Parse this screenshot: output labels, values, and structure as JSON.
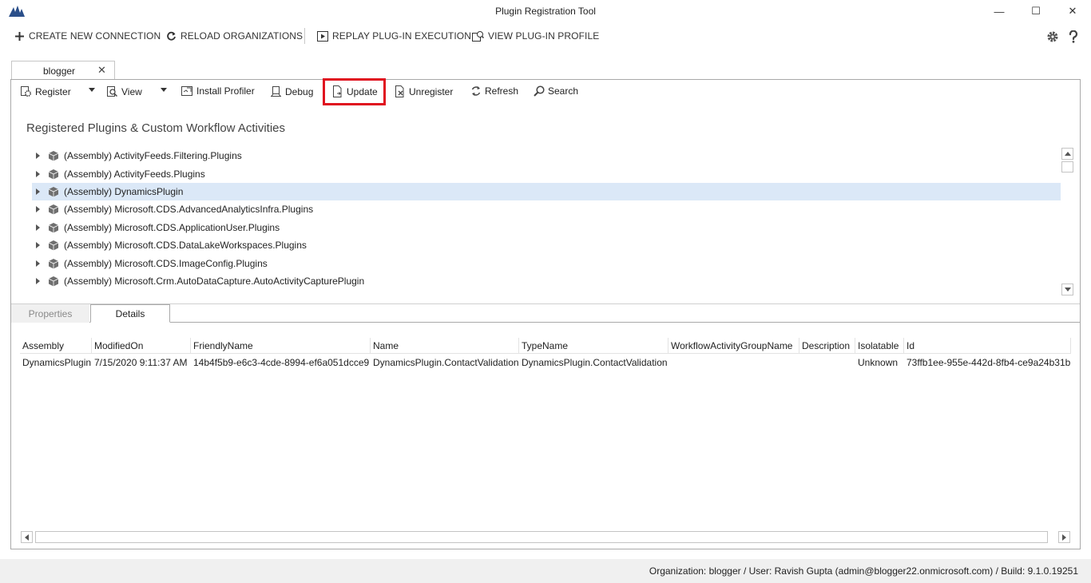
{
  "window": {
    "title": "Plugin Registration Tool",
    "controls": {
      "minimize": "—",
      "maximize": "☐",
      "close": "✕"
    }
  },
  "commandbar": {
    "create": "CREATE NEW CONNECTION",
    "reload": "RELOAD ORGANIZATIONS",
    "replay": "REPLAY PLUG-IN EXECUTION",
    "profile": "VIEW PLUG-IN PROFILE"
  },
  "connection_tab": {
    "label": "blogger",
    "close": "✕"
  },
  "toolbar": {
    "register": "Register",
    "view": "View",
    "install_profiler": "Install Profiler",
    "debug": "Debug",
    "update": "Update",
    "unregister": "Unregister",
    "refresh": "Refresh",
    "search": "Search"
  },
  "section_title": "Registered Plugins & Custom Workflow Activities",
  "tree": {
    "items": [
      {
        "label": "(Assembly) ActivityFeeds.Filtering.Plugins"
      },
      {
        "label": "(Assembly) ActivityFeeds.Plugins"
      },
      {
        "label": "(Assembly) DynamicsPlugin"
      },
      {
        "label": "(Assembly) Microsoft.CDS.AdvancedAnalyticsInfra.Plugins"
      },
      {
        "label": "(Assembly) Microsoft.CDS.ApplicationUser.Plugins"
      },
      {
        "label": "(Assembly) Microsoft.CDS.DataLakeWorkspaces.Plugins"
      },
      {
        "label": "(Assembly) Microsoft.CDS.ImageConfig.Plugins"
      },
      {
        "label": "(Assembly) Microsoft.Crm.AutoDataCapture.AutoActivityCapturePlugin"
      }
    ],
    "selected_label": "(Assembly) DynamicsPlugin"
  },
  "lower_tabs": {
    "properties": "Properties",
    "details": "Details"
  },
  "grid": {
    "columns": [
      "Assembly",
      "ModifiedOn",
      "FriendlyName",
      "Name",
      "TypeName",
      "WorkflowActivityGroupName",
      "Description",
      "Isolatable",
      "Id"
    ],
    "row": {
      "assembly": "DynamicsPlugin",
      "modified_on": "7/15/2020 9:11:37 AM",
      "friendly_name": "14b4f5b9-e6c3-4cde-8994-ef6a051dcce9",
      "name": "DynamicsPlugin.ContactValidation",
      "type_name": "DynamicsPlugin.ContactValidation",
      "workflow_activity_group_name": "",
      "description": "",
      "isolatable": "Unknown",
      "id": "73ffb1ee-955e-442d-8fb4-ce9a24b31b"
    }
  },
  "status": "Organization: blogger / User: Ravish Gupta (admin@blogger22.onmicrosoft.com) / Build: 9.1.0.19251",
  "colors": {
    "selection": "#dbe8f7",
    "highlight_border": "#e0101f",
    "status_bg": "#f0f0f0"
  }
}
